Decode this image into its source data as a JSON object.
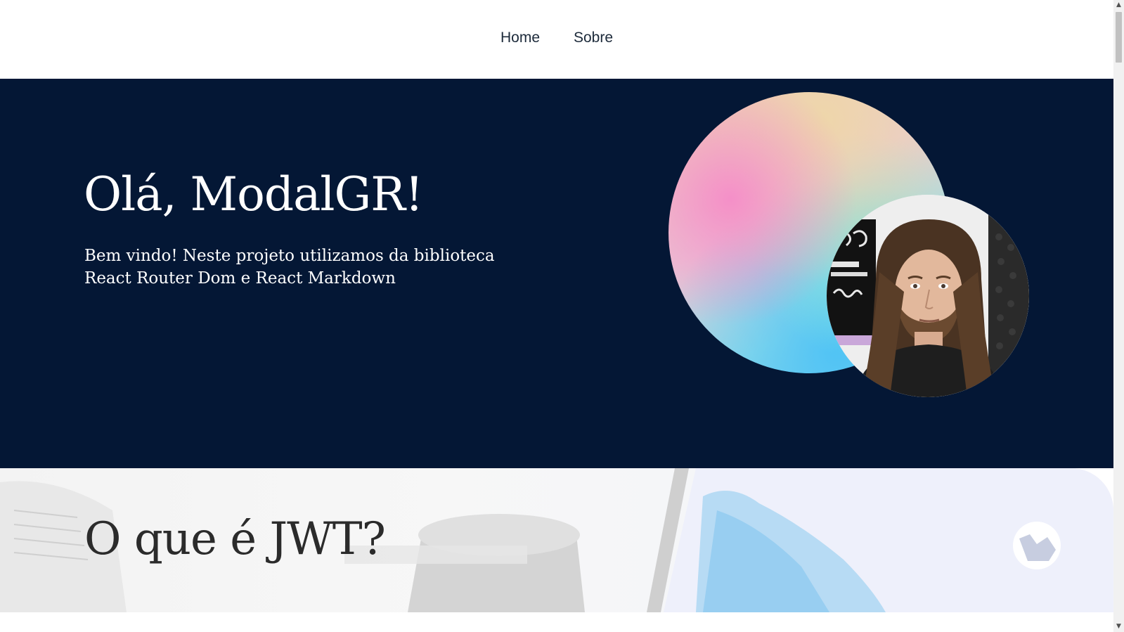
{
  "nav": {
    "items": [
      {
        "label": "Home"
      },
      {
        "label": "Sobre"
      }
    ]
  },
  "hero": {
    "title": "Olá, ModalGR!",
    "description": "Bem vindo! Neste projeto utilizamos da biblioteca React Router Dom e React Markdown",
    "background_color": "#041735"
  },
  "section2": {
    "title": "O que é JWT?"
  },
  "scrollbar": {
    "up_icon": "chevron-up-icon",
    "down_icon": "chevron-down-icon",
    "up_glyph": "▲",
    "down_glyph": "▼"
  }
}
